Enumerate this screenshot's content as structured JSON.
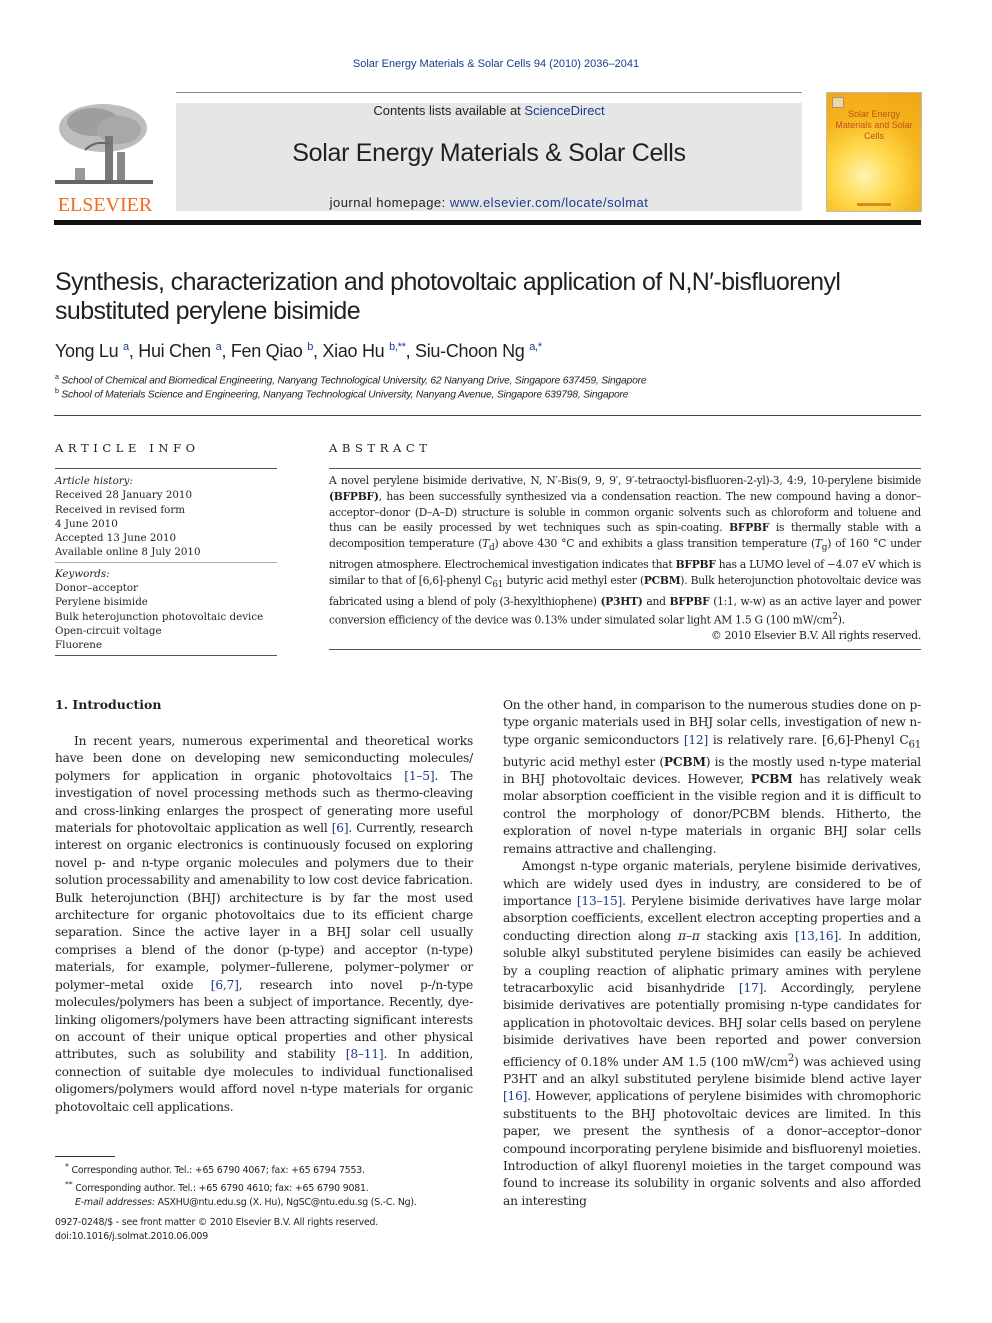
{
  "running_head": "Solar Energy Materials & Solar Cells 94 (2010) 2036–2041",
  "publisher": {
    "logo_text": "ELSEVIER",
    "logo_color": "#f06c1f"
  },
  "banner": {
    "contents_prefix": "Contents lists available at ",
    "contents_link": "ScienceDirect",
    "journal_title": "Solar Energy Materials & Solar Cells",
    "homepage_prefix": "journal homepage: ",
    "homepage_link": "www.elsevier.com/locate/solmat"
  },
  "cover": {
    "title": "Solar Energy Materials and Solar Cells"
  },
  "article": {
    "title": "Synthesis, characterization and photovoltaic application of N,N′-bisfluorenyl substituted perylene bisimide",
    "authors": [
      {
        "name": "Yong Lu",
        "sup": "a",
        "sep": ", "
      },
      {
        "name": "Hui Chen",
        "sup": "a",
        "sep": ", "
      },
      {
        "name": "Fen Qiao",
        "sup": "b",
        "sep": ", "
      },
      {
        "name": "Xiao Hu",
        "sup": "b,**",
        "sep": ", "
      },
      {
        "name": "Siu-Choon Ng",
        "sup": "a,*",
        "sep": ""
      }
    ],
    "affiliations": [
      {
        "mark": "a",
        "text": "School of Chemical and Biomedical Engineering, Nanyang Technological University, 62 Nanyang Drive, Singapore 637459, Singapore"
      },
      {
        "mark": "b",
        "text": "School of Materials Science and Engineering, Nanyang Technological University, Nanyang Avenue, Singapore 639798, Singapore"
      }
    ]
  },
  "article_info": {
    "heading": "ARTICLE INFO",
    "history_label": "Article history:",
    "history": [
      "Received 28 January 2010",
      "Received in revised form",
      "4 June 2010",
      "Accepted 13 June 2010",
      "Available online 8 July 2010"
    ],
    "keywords_label": "Keywords:",
    "keywords": [
      "Donor–acceptor",
      "Perylene bisimide",
      "Bulk heterojunction photovoltaic device",
      "Open-circuit voltage",
      "Fluorene"
    ]
  },
  "abstract": {
    "heading": "ABSTRACT",
    "p1": "A novel perylene bisimide derivative, N, N′-Bis(9, 9, 9′, 9′-tetraoctyl-bisfluoren-2-yl)-3, 4:9, 10-perylene bisimide ",
    "bfpbf_paren": "(BFPBF)",
    "p2": ", has been successfully synthesized via a condensation reaction. The new compound having a donor–acceptor–donor (D–A–D) structure is soluble in common organic solvents such as chloroform and toluene and thus can be easily processed by wet techniques such as spin-coating. ",
    "bfpbf": "BFPBF",
    "p3a": " is thermally stable with a decomposition temperature (",
    "td": "T",
    "td_sub": "d",
    "p3b": ") above 430 °C and exhibits a glass transition temperature (",
    "tg": "T",
    "tg_sub": "g",
    "p3c": ") of 160 °C under nitrogen atmosphere. Electrochemical investigation indicates that ",
    "p4": " has a LUMO level of −4.07 eV which is similar to that of [6,6]-phenyl C",
    "c61_sub": "61",
    "p5": " butyric acid methyl ester (",
    "pcbm": "PCBM",
    "p6": "). Bulk heterojunction photovoltaic device was fabricated using a blend of poly (3-hexylthiophene) ",
    "p3ht": "(P3HT)",
    "p7": " and ",
    "p8": " (1:1, w-w) as an active layer and power conversion efficiency of the device was 0.13% under simulated solar light AM 1.5 G (100 mW/cm",
    "sq": "2",
    "p9": ").",
    "copyright": "© 2010 Elsevier B.V. All rights reserved."
  },
  "intro": {
    "heading": "1.  Introduction",
    "left": {
      "t1": "In recent years, numerous experimental and theoretical works have been done on developing new semiconducting molecules/ polymers for application in organic photovoltaics ",
      "c1": "[1–5]",
      "t2": ". The investigation of novel processing methods such as thermo-cleaving and cross-linking enlarges the prospect of generating more useful materials for photovoltaic application as well ",
      "c2": "[6]",
      "t3": ". Currently, research interest on organic electronics is continuously focused on exploring novel p- and n-type organic molecules and polymers due to their solution processability and amenability to low cost device fabrication. Bulk heterojunction (BHJ) architecture is by far the most used architecture for organic photovoltaics due to its efficient charge separation. Since the active layer in a BHJ solar cell usually comprises a blend of the donor (p-type) and acceptor (n-type) materials, for example, polymer–fullerene, polymer–polymer or polymer–metal oxide ",
      "c3": "[6,7]",
      "t4": ", research into novel p-/n-type molecules/polymers has been a subject of importance. Recently, dye-linking oligomers/polymers have been attracting significant interests on account of their unique optical properties and other physical attributes, such as solubility and stability ",
      "c4": "[8–11]",
      "t5": ". In addition, connection of suitable dye molecules to individual functionalised oligomers/polymers would afford novel n-type materials for organic photovoltaic cell applications."
    },
    "right": {
      "t1": "On the other hand, in comparison to the numerous studies done on p-type organic materials used in BHJ solar cells, investigation of new n-type organic semiconductors ",
      "c1": "[12]",
      "t2": " is relatively rare. [6,6]-Phenyl C",
      "sub61": "61",
      "t3": " butyric acid methyl ester (",
      "pcbm": "PCBM",
      "t4": ") is the mostly used n-type material in BHJ photovoltaic devices. However, ",
      "t5": " has relatively weak molar absorption coefficient in the visible region and it is difficult to control the morphology of donor/PCBM blends. Hitherto, the exploration of novel n-type materials in organic BHJ solar cells remains attractive and challenging.",
      "p2_t1": "Amongst n-type organic materials, perylene bisimide derivatives, which are widely used dyes in industry, are considered to be of importance ",
      "p2_c1": "[13–15]",
      "p2_t2": ". Perylene bisimide derivatives have large molar absorption coefficients, excellent electron accepting properties and a conducting direction along ",
      "pi": "π–π",
      "p2_t3": " stacking axis ",
      "p2_c2": "[13,16]",
      "p2_t4": ". In addition, soluble alkyl substituted perylene bisimides can easily be achieved by a coupling reaction of aliphatic primary amines with perylene tetracarboxylic acid bisanhydride ",
      "p2_c3": "[17]",
      "p2_t5": ". Accordingly, perylene bisimide derivatives are potentially promising n-type candidates for application in photovoltaic devices. BHJ solar cells based on perylene bisimide derivatives have been reported and power conversion efficiency of 0.18% under AM 1.5 (100 mW/cm",
      "p2_sq": "2",
      "p2_t6": ") was achieved using P3HT and an alkyl substituted perylene bisimide blend active layer ",
      "p2_c4": "[16]",
      "p2_t7": ". However, applications of perylene bisimides with chromophoric substituents to the BHJ photovoltaic devices are limited. In this paper, we present the synthesis of a donor–acceptor–donor compound incorporating perylene bisimide and bisfluorenyl moieties. Introduction of alkyl fluorenyl moieties in the target compound was found to increase its solubility in organic solvents and also afforded an interesting"
    }
  },
  "footnotes": {
    "fn1_mark": "*",
    "fn1": " Corresponding author. Tel.: +65 6790 4067; fax: +65 6794 7553.",
    "fn2_mark": "**",
    "fn2": " Corresponding author. Tel.: +65 6790 4610; fax: +65 6790 9081.",
    "email_label": "E-mail addresses:",
    "emails": " ASXHU@ntu.edu.sg (X. Hu), NgSC@ntu.edu.sg (S.-C. Ng).",
    "front_matter": "0927-0248/$ - see front matter © 2010 Elsevier B.V. All rights reserved.",
    "doi": "doi:10.1016/j.solmat.2010.06.009"
  }
}
